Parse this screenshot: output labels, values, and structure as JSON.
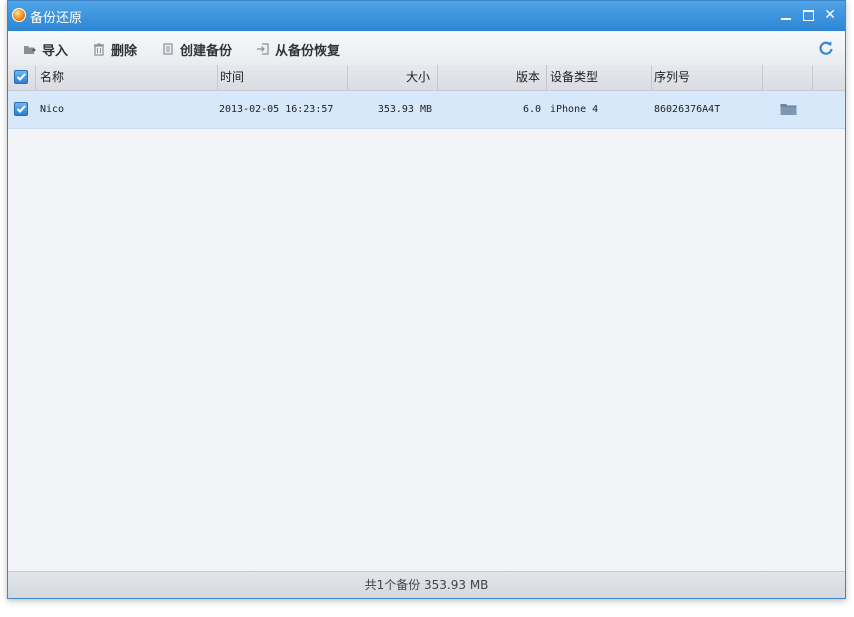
{
  "window": {
    "title": "备份还原",
    "controls": {
      "minimize": "minimize",
      "maximize": "maximize",
      "close": "✕"
    }
  },
  "toolbar": {
    "import_label": "导入",
    "delete_label": "删除",
    "create_label": "创建备份",
    "restore_label": "从备份恢复",
    "refresh_icon": "refresh-icon"
  },
  "table": {
    "columns": {
      "name": "名称",
      "time": "时间",
      "size": "大小",
      "version": "版本",
      "device_type": "设备类型",
      "serial": "序列号"
    },
    "select_all_checked": true,
    "rows": [
      {
        "checked": true,
        "name": "Nico",
        "time": "2013-02-05 16:23:57",
        "size": "353.93 MB",
        "version": "6.0",
        "device_type": "iPhone 4",
        "serial": "86026376A4T",
        "action_icon": "folder-icon"
      }
    ]
  },
  "status": {
    "summary": "共1个备份 353.93 MB"
  },
  "colors": {
    "titlebar": "#2e86d4",
    "selected_row": "#d7e8fb",
    "checkbox": "#2b7fd0"
  }
}
